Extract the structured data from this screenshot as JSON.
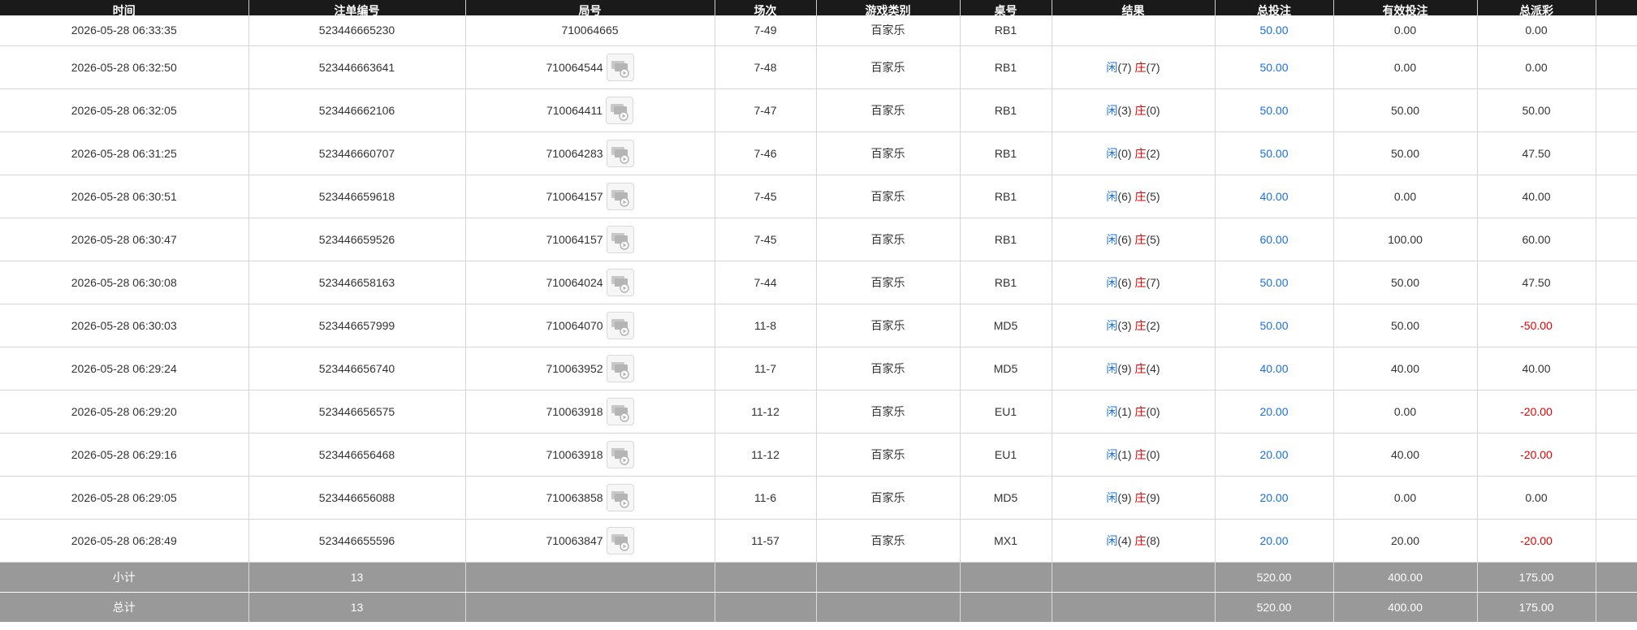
{
  "headers": [
    "时间",
    "注单编号",
    "局号",
    "场次",
    "游戏类别",
    "桌号",
    "结果",
    "总投注",
    "有效投注",
    "总派彩",
    ""
  ],
  "result_labels": {
    "player": "闲",
    "banker": "庄"
  },
  "rows": [
    {
      "time": "2026-05-28 06:33:35",
      "bet_id": "523446665230",
      "round": "710064665",
      "session": "7-49",
      "game": "百家乐",
      "table": "RB1",
      "has_replay": false,
      "result": null,
      "total_bet": "50.00",
      "valid_bet": "0.00",
      "payout": "0.00",
      "payout_negative": false
    },
    {
      "time": "2026-05-28 06:32:50",
      "bet_id": "523446663641",
      "round": "710064544",
      "session": "7-48",
      "game": "百家乐",
      "table": "RB1",
      "has_replay": true,
      "result": {
        "player": "(7)",
        "banker": "(7)"
      },
      "total_bet": "50.00",
      "valid_bet": "0.00",
      "payout": "0.00",
      "payout_negative": false
    },
    {
      "time": "2026-05-28 06:32:05",
      "bet_id": "523446662106",
      "round": "710064411",
      "session": "7-47",
      "game": "百家乐",
      "table": "RB1",
      "has_replay": true,
      "result": {
        "player": "(3)",
        "banker": "(0)"
      },
      "total_bet": "50.00",
      "valid_bet": "50.00",
      "payout": "50.00",
      "payout_negative": false
    },
    {
      "time": "2026-05-28 06:31:25",
      "bet_id": "523446660707",
      "round": "710064283",
      "session": "7-46",
      "game": "百家乐",
      "table": "RB1",
      "has_replay": true,
      "result": {
        "player": "(0)",
        "banker": "(2)"
      },
      "total_bet": "50.00",
      "valid_bet": "50.00",
      "payout": "47.50",
      "payout_negative": false
    },
    {
      "time": "2026-05-28 06:30:51",
      "bet_id": "523446659618",
      "round": "710064157",
      "session": "7-45",
      "game": "百家乐",
      "table": "RB1",
      "has_replay": true,
      "result": {
        "player": "(6)",
        "banker": "(5)"
      },
      "total_bet": "40.00",
      "valid_bet": "0.00",
      "payout": "40.00",
      "payout_negative": false
    },
    {
      "time": "2026-05-28 06:30:47",
      "bet_id": "523446659526",
      "round": "710064157",
      "session": "7-45",
      "game": "百家乐",
      "table": "RB1",
      "has_replay": true,
      "result": {
        "player": "(6)",
        "banker": "(5)"
      },
      "total_bet": "60.00",
      "valid_bet": "100.00",
      "payout": "60.00",
      "payout_negative": false
    },
    {
      "time": "2026-05-28 06:30:08",
      "bet_id": "523446658163",
      "round": "710064024",
      "session": "7-44",
      "game": "百家乐",
      "table": "RB1",
      "has_replay": true,
      "result": {
        "player": "(6)",
        "banker": "(7)"
      },
      "total_bet": "50.00",
      "valid_bet": "50.00",
      "payout": "47.50",
      "payout_negative": false
    },
    {
      "time": "2026-05-28 06:30:03",
      "bet_id": "523446657999",
      "round": "710064070",
      "session": "11-8",
      "game": "百家乐",
      "table": "MD5",
      "has_replay": true,
      "result": {
        "player": "(3)",
        "banker": "(2)"
      },
      "total_bet": "50.00",
      "valid_bet": "50.00",
      "payout": "-50.00",
      "payout_negative": true
    },
    {
      "time": "2026-05-28 06:29:24",
      "bet_id": "523446656740",
      "round": "710063952",
      "session": "11-7",
      "game": "百家乐",
      "table": "MD5",
      "has_replay": true,
      "result": {
        "player": "(9)",
        "banker": "(4)"
      },
      "total_bet": "40.00",
      "valid_bet": "40.00",
      "payout": "40.00",
      "payout_negative": false
    },
    {
      "time": "2026-05-28 06:29:20",
      "bet_id": "523446656575",
      "round": "710063918",
      "session": "11-12",
      "game": "百家乐",
      "table": "EU1",
      "has_replay": true,
      "result": {
        "player": "(1)",
        "banker": "(0)"
      },
      "total_bet": "20.00",
      "valid_bet": "0.00",
      "payout": "-20.00",
      "payout_negative": true
    },
    {
      "time": "2026-05-28 06:29:16",
      "bet_id": "523446656468",
      "round": "710063918",
      "session": "11-12",
      "game": "百家乐",
      "table": "EU1",
      "has_replay": true,
      "result": {
        "player": "(1)",
        "banker": "(0)"
      },
      "total_bet": "20.00",
      "valid_bet": "40.00",
      "payout": "-20.00",
      "payout_negative": true
    },
    {
      "time": "2026-05-28 06:29:05",
      "bet_id": "523446656088",
      "round": "710063858",
      "session": "11-6",
      "game": "百家乐",
      "table": "MD5",
      "has_replay": true,
      "result": {
        "player": "(9)",
        "banker": "(9)"
      },
      "total_bet": "20.00",
      "valid_bet": "0.00",
      "payout": "0.00",
      "payout_negative": false
    },
    {
      "time": "2026-05-28 06:28:49",
      "bet_id": "523446655596",
      "round": "710063847",
      "session": "11-57",
      "game": "百家乐",
      "table": "MX1",
      "has_replay": true,
      "result": {
        "player": "(4)",
        "banker": "(8)"
      },
      "total_bet": "20.00",
      "valid_bet": "20.00",
      "payout": "-20.00",
      "payout_negative": true
    }
  ],
  "subtotal": {
    "label": "小计",
    "count": "13",
    "total_bet": "520.00",
    "valid_bet": "400.00",
    "payout": "175.00"
  },
  "total": {
    "label": "总计",
    "count": "13",
    "total_bet": "520.00",
    "valid_bet": "400.00",
    "payout": "175.00"
  },
  "colors": {
    "header_bg": "#1a1a1a",
    "summary_bg": "#999999",
    "blue": "#1a6fe6",
    "red": "#e60000"
  },
  "icons": {
    "replay": "game-replay-icon"
  }
}
